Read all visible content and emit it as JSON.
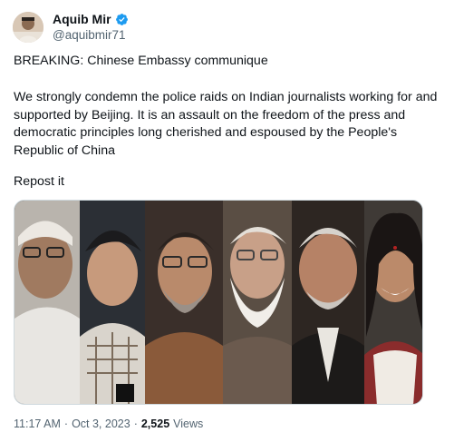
{
  "author": {
    "name": "Aquib Mir",
    "handle": "@aquibmir71",
    "verified": true,
    "verified_color": "#1d9bf0"
  },
  "tweet": {
    "headline": "BREAKING: Chinese Embassy communique",
    "body": "We strongly condemn the police raids on Indian journalists working for and supported by Beijing. It is an assault on the freedom of the press and democratic principles long cherished and espoused by the People's Republic of China",
    "closing": "Repost it"
  },
  "media": {
    "description_icon": "photo-collage",
    "panels": 6
  },
  "meta": {
    "time": "11:17 AM",
    "separator1": "·",
    "date": "Oct 3, 2023",
    "separator2": "·",
    "views_count": "2,525",
    "views_label": "Views"
  }
}
